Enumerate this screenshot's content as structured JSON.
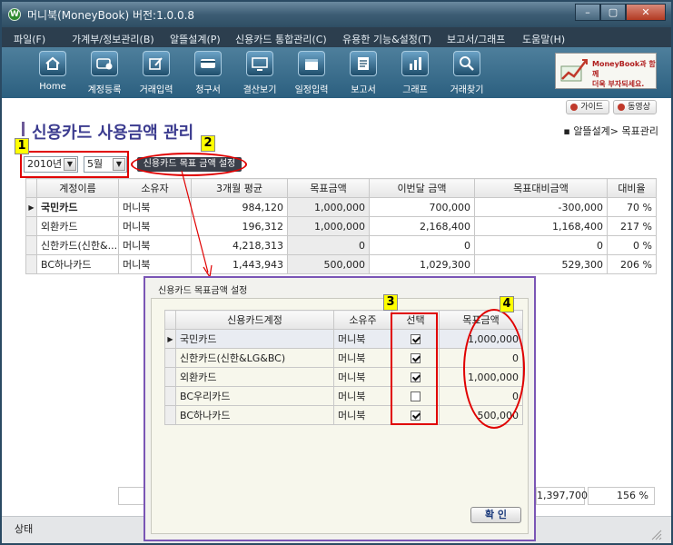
{
  "window": {
    "title": "머니북(MoneyBook) 버전:1.0.0.8",
    "app_icon": "W",
    "min_label": "–",
    "max_label": "▢",
    "close_label": "✕"
  },
  "menu": [
    {
      "label": "파일(F)"
    },
    {
      "label": "가계부/정보관리(B)"
    },
    {
      "label": "알뜰설계(P)"
    },
    {
      "label": "신용카드 통합관리(C)"
    },
    {
      "label": "유용한 기능&설정(T)"
    },
    {
      "label": "보고서/그래프"
    },
    {
      "label": "도움말(H)"
    }
  ],
  "toolbar": [
    {
      "label": "Home",
      "icon": "home-icon"
    },
    {
      "label": "계정등록",
      "icon": "card-register-icon"
    },
    {
      "label": "거래입력",
      "icon": "edit-icon"
    },
    {
      "label": "청구서",
      "icon": "card-icon"
    },
    {
      "label": "결산보기",
      "icon": "monitor-icon"
    },
    {
      "label": "일정입력",
      "icon": "calendar-icon"
    },
    {
      "label": "보고서",
      "icon": "report-icon"
    },
    {
      "label": "그래프",
      "icon": "bar-chart-icon"
    },
    {
      "label": "거래찾기",
      "icon": "search-icon"
    }
  ],
  "ad": {
    "line1": "MoneyBook과 함께",
    "line2": "더욱 부자되세요."
  },
  "guide": {
    "guide_label": "가이드",
    "video_label": "동영상"
  },
  "page": {
    "title": "신용카드 사용금액 관리",
    "breadcrumb": "▪ 알뜰설계> 목표관리"
  },
  "filters": {
    "year": "2010년",
    "month": "5월",
    "goal_button": "신용카드 목표 금액 설정"
  },
  "callouts": [
    "1",
    "2",
    "3",
    "4"
  ],
  "main_table": {
    "headers": [
      "계정이름",
      "소유자",
      "3개월 평균",
      "목표금액",
      "이번달 금액",
      "목표대비금액",
      "대비율"
    ],
    "rows": [
      {
        "marker": "▶",
        "cells": [
          "국민카드",
          "머니북",
          "984,120",
          "1,000,000",
          "700,000",
          "-300,000",
          "70 %"
        ]
      },
      {
        "marker": "",
        "cells": [
          "외환카드",
          "머니북",
          "196,312",
          "1,000,000",
          "2,168,400",
          "1,168,400",
          "217 %"
        ]
      },
      {
        "marker": "",
        "cells": [
          "신한카드(신한&...",
          "머니북",
          "4,218,313",
          "0",
          "0",
          "0",
          "0 %"
        ]
      },
      {
        "marker": "",
        "cells": [
          "BC하나카드",
          "머니북",
          "1,443,943",
          "500,000",
          "1,029,300",
          "529,300",
          "206 %"
        ]
      }
    ],
    "totals": {
      "diff": "1,397,700",
      "ratio": "156 %"
    }
  },
  "status": {
    "text": "상태"
  },
  "dialog": {
    "title": "신용카드 목표금액 설정",
    "headers": [
      "신용카드계정",
      "소유주",
      "선택",
      "목표금액"
    ],
    "rows": [
      {
        "marker": "▶",
        "account": "국민카드",
        "owner": "머니북",
        "checked": true,
        "goal": "1,000,000"
      },
      {
        "marker": "",
        "account": "신한카드(신한&LG&BC)",
        "owner": "머니북",
        "checked": true,
        "goal": "0"
      },
      {
        "marker": "",
        "account": "외환카드",
        "owner": "머니북",
        "checked": true,
        "goal": "1,000,000"
      },
      {
        "marker": "",
        "account": "BC우리카드",
        "owner": "머니북",
        "checked": false,
        "goal": "0"
      },
      {
        "marker": "",
        "account": "BC하나카드",
        "owner": "머니북",
        "checked": true,
        "goal": "500,000"
      }
    ],
    "ok_label": "확 인"
  }
}
